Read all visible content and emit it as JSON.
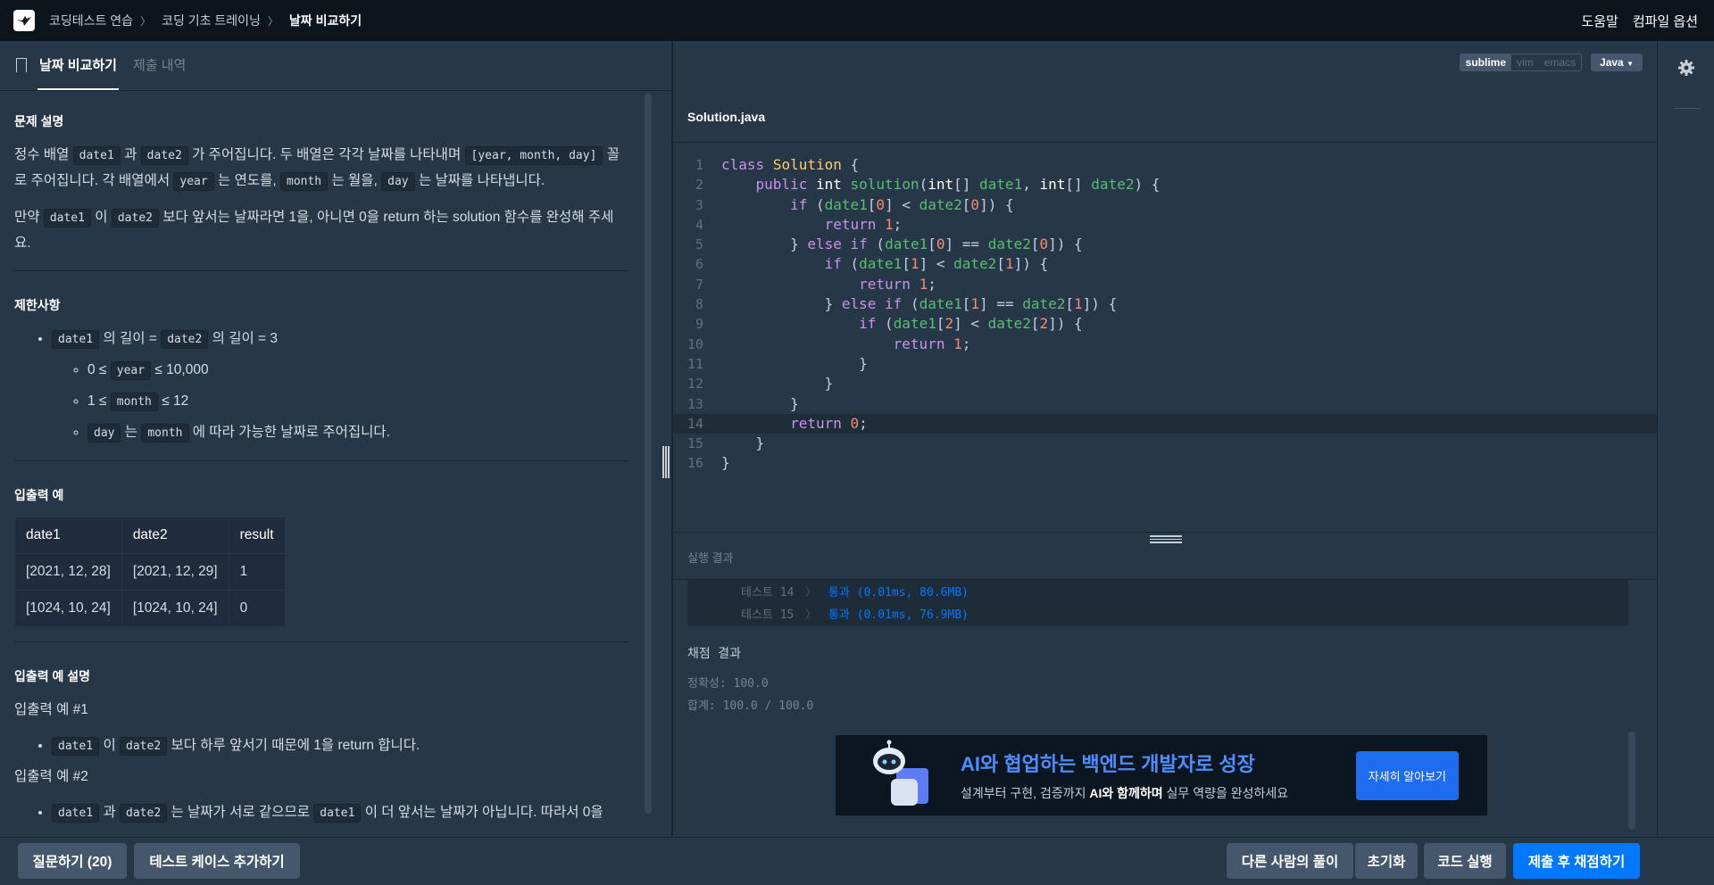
{
  "topnav": {
    "breadcrumbs": [
      "코딩테스트 연습",
      "코딩 기초 트레이닝",
      "날짜 비교하기"
    ],
    "help": "도움말",
    "compile_options": "컴파일 옵션"
  },
  "tabs": {
    "problem": "날짜 비교하기",
    "submissions": "제출 내역"
  },
  "problem": {
    "desc_heading": "문제 설명",
    "p1": {
      "a": "정수 배열 ",
      "c1": "date1",
      "b": " 과 ",
      "c2": "date2",
      "c": " 가 주어집니다. 두 배열은 각각 날짜를 나타내며 ",
      "c3": "[year, month, day]",
      "d": " 꼴로 주어집니다. 각 배열에서 ",
      "c4": "year",
      "e": " 는 연도를, ",
      "c5": "month",
      "f": " 는 월을, ",
      "c6": "day",
      "g": " 는 날짜를 나타냅니다."
    },
    "p2": {
      "a": "만약 ",
      "c1": "date1",
      "b": " 이 ",
      "c2": "date2",
      "c": " 보다 앞서는 날짜라면 1을, 아니면 0을 return 하는 solution 함수를 완성해 주세요."
    },
    "limit_heading": "제한사항",
    "limits": {
      "l1": {
        "c1": "date1",
        "a": " 의 길이 = ",
        "c2": "date2",
        "b": " 의 길이 = 3"
      },
      "s1": {
        "a": "0 ≤ ",
        "c": "year",
        "b": " ≤ 10,000"
      },
      "s2": {
        "a": "1 ≤ ",
        "c": "month",
        "b": " ≤ 12"
      },
      "s3": {
        "c1": "day",
        "a": " 는 ",
        "c2": "month",
        "b": " 에 따라 가능한 날짜로 주어집니다."
      }
    },
    "io_heading": "입출력 예",
    "io_table": {
      "headers": [
        "date1",
        "date2",
        "result"
      ],
      "rows": [
        [
          "[2021, 12, 28]",
          "[2021, 12, 29]",
          "1"
        ],
        [
          "[1024, 10, 24]",
          "[1024, 10, 24]",
          "0"
        ]
      ]
    },
    "io_desc_heading": "입출력 예 설명",
    "ex1_title": "입출력 예 #1",
    "ex1": {
      "c1": "date1",
      "a": " 이 ",
      "c2": "date2",
      "b": " 보다 하루 앞서기 때문에 1을 return 합니다."
    },
    "ex2_title": "입출력 예 #2",
    "ex2": {
      "c1": "date1",
      "a": " 과 ",
      "c2": "date2",
      "b": " 는 날짜가 서로 같으므로 ",
      "c3": "date1",
      "c": " 이 더 앞서는 날짜가 아닙니다. 따라서 0을 return 합니다."
    }
  },
  "editor": {
    "modes": [
      "sublime",
      "vim",
      "emacs"
    ],
    "language": "Java",
    "filename": "Solution.java",
    "line_numbers": [
      "1",
      "2",
      "3",
      "4",
      "5",
      "6",
      "7",
      "8",
      "9",
      "10",
      "11",
      "12",
      "13",
      "14",
      "15",
      "16"
    ]
  },
  "result": {
    "heading": "실행 결과",
    "tests": [
      {
        "name": "테스트 14",
        "status": "통과 (0.01ms, 80.6MB)"
      },
      {
        "name": "테스트 15",
        "status": "통과 (0.01ms, 76.9MB)"
      }
    ],
    "grade_title": "채점 결과",
    "accuracy": "정확성: 100.0",
    "total": "합계: 100.0 / 100.0"
  },
  "ad": {
    "title": "AI와 협업하는 백엔드 개발자로 성장",
    "sub_a": "설계부터 구현, 검증까지 ",
    "sub_b": "AI와 함께하며",
    "sub_c": " 실무 역량을 완성하세요",
    "button": "자세히 알아보기"
  },
  "bottom": {
    "ask": "질문하기 (20)",
    "add_test": "테스트 케이스 추가하기",
    "others": "다른 사람의 풀이",
    "reset": "초기화",
    "run": "코드 실행",
    "submit": "제출 후 채점하기"
  },
  "colors": {
    "accent": "#0078ff",
    "background": "#263747",
    "nav": "#0c151c"
  }
}
